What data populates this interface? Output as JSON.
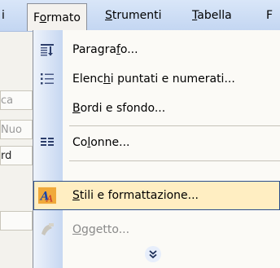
{
  "menubar": {
    "left_fragment": "i",
    "items": [
      {
        "label": "Formato",
        "underline": "o"
      },
      {
        "label": "Strumenti",
        "underline": "S"
      },
      {
        "label": "Tabella",
        "underline": "T"
      },
      {
        "label": "F"
      }
    ]
  },
  "background": {
    "fragments": [
      "ca",
      "Nuo",
      "rd",
      ""
    ]
  },
  "menu": {
    "items": [
      {
        "label": "Paragrafo...",
        "icon": "paragraph-icon",
        "enabled": true
      },
      {
        "label": "Elenchi puntati e numerati...",
        "icon": "bullets-icon",
        "enabled": true
      },
      {
        "label": "Bordi e sfondo...",
        "icon": "",
        "enabled": true
      },
      {
        "label": "Colonne...",
        "icon": "columns-icon",
        "enabled": true
      },
      {
        "label": "Stili e formattazione...",
        "icon": "styles-icon",
        "enabled": true,
        "highlighted": true
      },
      {
        "label": "Oggetto...",
        "icon": "object-icon",
        "enabled": false
      }
    ],
    "expand_icon": "double-chevron-down-icon"
  },
  "colors": {
    "highlight_bg": "#ffeec2",
    "highlight_border": "#2b4e8c",
    "gutter_light": "#eef3fb",
    "gutter_dark": "#c6d7f1",
    "menu_bg": "#fbfaf6"
  }
}
